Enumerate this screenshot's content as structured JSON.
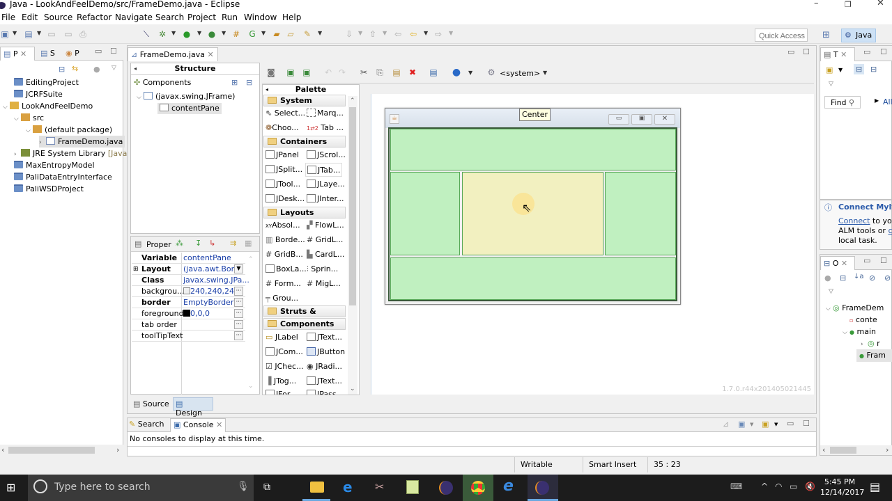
{
  "window": {
    "title": "Java - LookAndFeelDemo/src/FrameDemo.java - Eclipse",
    "minimize": "–",
    "restore": "❐",
    "close": "✕"
  },
  "menu": [
    "File",
    "Edit",
    "Source",
    "Refactor",
    "Navigate",
    "Search",
    "Project",
    "Run",
    "Window",
    "Help"
  ],
  "toolbar": {
    "quick_access_placeholder": "Quick Access",
    "perspective": "Java"
  },
  "package_explorer": {
    "tabs": [
      "P",
      "S",
      "P"
    ],
    "items": [
      {
        "label": "EditingProject",
        "type": "folder"
      },
      {
        "label": "JCRFSuite",
        "type": "folder"
      },
      {
        "label": "LookAndFeelDemo",
        "type": "project",
        "expanded": true
      },
      {
        "label": "src",
        "type": "package-root",
        "expanded": true
      },
      {
        "label": "(default package)",
        "type": "package",
        "expanded": true
      },
      {
        "label": "FrameDemo.java",
        "type": "java-file",
        "selected": true
      },
      {
        "label": "JRE System Library",
        "suffix": "[Java",
        "type": "library"
      },
      {
        "label": "MaxEntropyModel",
        "type": "folder"
      },
      {
        "label": "PaliDataEntryInterface",
        "type": "folder"
      },
      {
        "label": "PaliWSDProject",
        "type": "folder"
      }
    ]
  },
  "editor": {
    "tab_label": "FrameDemo.java",
    "structure": {
      "title": "Structure",
      "components_label": "Components",
      "tree": [
        {
          "label": "(javax.swing.JFrame)",
          "depth": 0
        },
        {
          "label": "contentPane",
          "depth": 1,
          "selected": true
        }
      ]
    },
    "properties": {
      "title": "Proper",
      "rows": [
        {
          "key": "Variable",
          "value": "contentPane",
          "bold": true
        },
        {
          "key": "Layout",
          "value": "(java.awt.Bor...",
          "bold": true,
          "expandable": true,
          "dropdown": true
        },
        {
          "key": "Class",
          "value": "javax.swing.JPa...",
          "bold": true
        },
        {
          "key": "backgrou...",
          "value": "240,240,240",
          "swatch": "#f0f0f0",
          "editor": true
        },
        {
          "key": "border",
          "value": "EmptyBorder",
          "bold": true,
          "editor": true
        },
        {
          "key": "foreground",
          "value": "0,0,0",
          "swatch": "#000000",
          "editor": true
        },
        {
          "key": "tab order",
          "value": "",
          "editor": true
        },
        {
          "key": "toolTipText",
          "value": "",
          "editor": true
        }
      ]
    },
    "palette": {
      "title": "Palette",
      "sections": [
        {
          "name": "System",
          "items": [
            "Select...",
            "Marq...",
            "Choo...",
            "Tab ..."
          ]
        },
        {
          "name": "Containers",
          "items": [
            "JPanel",
            "JScrol...",
            "JSplit...",
            "JTab...",
            "JTool...",
            "JLaye...",
            "JDesk...",
            "JInter..."
          ]
        },
        {
          "name": "Layouts",
          "items": [
            "Absol...",
            "FlowL...",
            "Borde...",
            "GridL...",
            "GridB...",
            "CardL...",
            "BoxLa...",
            "Sprin...",
            "Form...",
            "MigL...",
            "Grou..."
          ]
        },
        {
          "name": "Struts & Springs",
          "items": []
        },
        {
          "name": "Components",
          "items": [
            "JLabel",
            "JText...",
            "JCom...",
            "JButton",
            "JChec...",
            "JRadi...",
            "JTog...",
            "JText...",
            "JFor...",
            "JPass..."
          ]
        }
      ]
    },
    "design_toolbar": {
      "look_and_feel": "<system>"
    },
    "designer": {
      "tooltip": "Center",
      "regions": [
        "North",
        "West",
        "Center",
        "East",
        "South"
      ],
      "version": "1.7.0.r44x201405021445"
    },
    "bottom_tabs": [
      "Source",
      "Design"
    ],
    "active_bottom_tab": "Design"
  },
  "right_panels": {
    "task_list_tab": "T",
    "find_placeholder": "Find",
    "all_label": "All",
    "mylyn": {
      "title": "Connect Mylyn",
      "link": "Connect",
      "text1": " to you",
      "text2": "ALM tools or ",
      "link2": "cr",
      "text3": "local task."
    },
    "outline_tab": "O",
    "outline": [
      {
        "label": "FrameDem",
        "depth": 0
      },
      {
        "label": "conte",
        "depth": 1
      },
      {
        "label": "main",
        "depth": 1
      },
      {
        "label": "r",
        "depth": 2
      },
      {
        "label": "Fram",
        "depth": 1,
        "selected": true
      }
    ]
  },
  "console": {
    "tabs": [
      "Search",
      "Console"
    ],
    "active": "Console",
    "message": "No consoles to display at this time."
  },
  "status_bar": {
    "writable": "Writable",
    "insert_mode": "Smart Insert",
    "position": "35 : 23"
  },
  "taskbar": {
    "search_placeholder": "Type here to search",
    "time": "5:45 PM",
    "date": "12/14/2017"
  }
}
